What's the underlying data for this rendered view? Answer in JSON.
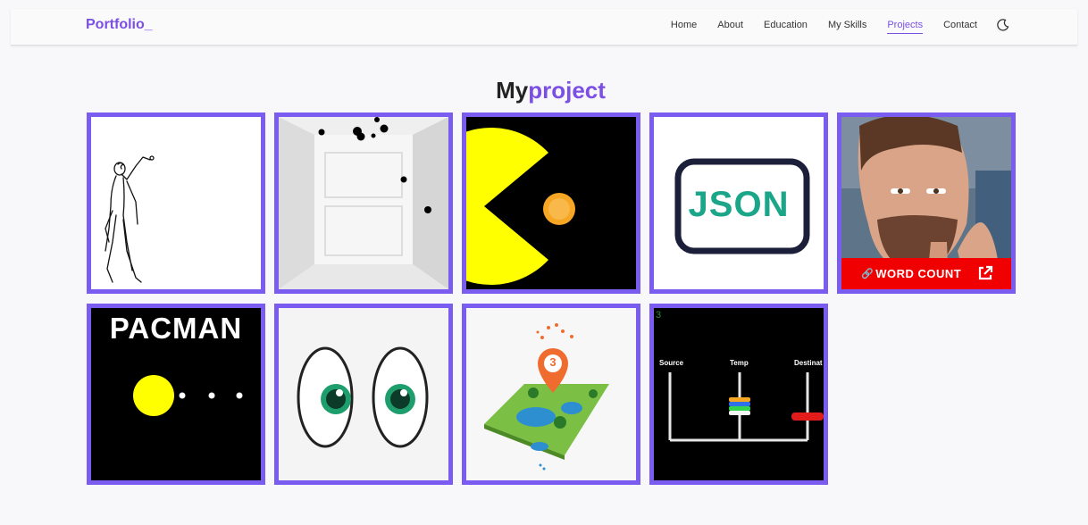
{
  "nav": {
    "brand": "Portfolio_",
    "links": [
      "Home",
      "About",
      "Education",
      "My Skills",
      "Projects",
      "Contact"
    ],
    "active": "Projects",
    "theme_icon": "moon-icon"
  },
  "section": {
    "title_part1": "My",
    "title_part2": "project"
  },
  "projects": {
    "overlay_label": "WORD COUNT",
    "pacman_title": "PACMAN",
    "json_text": "JSON",
    "pin_number": "3",
    "hanoi_counter": "3",
    "hanoi_source": "Source",
    "hanoi_temp": "Temp",
    "hanoi_destination": "Destinat"
  },
  "colors": {
    "accent": "#7b4fe3",
    "tile_border": "#7b5cf0",
    "overlay_red": "#f00000"
  }
}
